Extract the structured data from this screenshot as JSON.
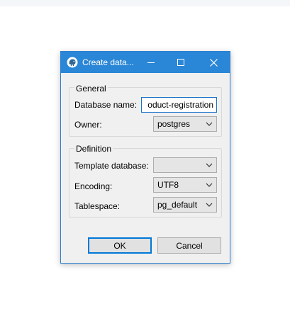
{
  "window": {
    "title": "Create data..."
  },
  "general": {
    "legend": "General",
    "database_name_label": "Database name:",
    "database_name_value": "oduct-registration",
    "owner_label": "Owner:",
    "owner_value": "postgres"
  },
  "definition": {
    "legend": "Definition",
    "template_label": "Template database:",
    "template_value": "",
    "encoding_label": "Encoding:",
    "encoding_value": "UTF8",
    "tablespace_label": "Tablespace:",
    "tablespace_value": "pg_default"
  },
  "buttons": {
    "ok": "OK",
    "cancel": "Cancel"
  },
  "colors": {
    "titlebar": "#2a86d6",
    "dialog_bg": "#f0f0f0",
    "focus": "#0078d7"
  },
  "icons": {
    "app": "elephant-icon",
    "minimize": "minimize-icon",
    "maximize": "maximize-icon",
    "close": "close-icon",
    "dropdown": "chevron-down-icon"
  }
}
